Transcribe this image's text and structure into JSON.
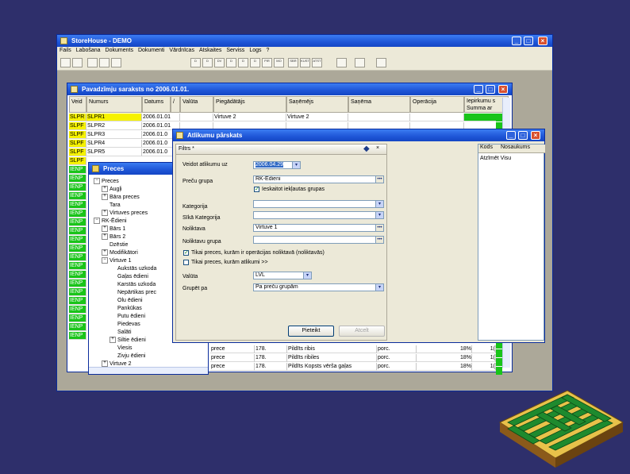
{
  "app": {
    "title": "StoreHouse - DEMO",
    "menu": [
      "Fails",
      "Labošana",
      "Dokuments",
      "Dokumenti",
      "Vārdnīcas",
      "Atskaites",
      "Serviss",
      "Logs",
      "?"
    ],
    "toolbar_buttons": [
      "D",
      "D",
      "DV",
      "D",
      "D",
      "D",
      "PIR",
      "MO",
      "SBR",
      "KUST",
      "ATST"
    ],
    "window_controls": [
      "_",
      "□",
      "×"
    ]
  },
  "list_window": {
    "title": "Pavadzīmju saraksts no 2006.01.01.",
    "columns": [
      "Veid",
      "Numurs",
      "Datums",
      "/",
      "Valūta",
      "Piegādātājs",
      "Saņēmējs",
      "Saņēma",
      "Operācija",
      "Iepirkumu s",
      "Summa ar"
    ],
    "rows": [
      {
        "type": "SLPR",
        "num": "SLPR1",
        "date": "2006.01.01",
        "supplier": "Virtuve 2",
        "receiver": "Virtuve 2"
      },
      {
        "type": "SLPF",
        "num": "SLPR2",
        "date": "2006.01.01",
        "supplier": "",
        "receiver": ""
      },
      {
        "type": "SLPF",
        "num": "SLPR3",
        "date": "2006.01.0",
        "supplier": "",
        "receiver": ""
      },
      {
        "type": "SLPF",
        "num": "SLPR4",
        "date": "2006.01.0",
        "supplier": "",
        "receiver": ""
      },
      {
        "type": "SLPF",
        "num": "SLPR5",
        "date": "2006.01.0",
        "supplier": "",
        "receiver": ""
      }
    ],
    "extra_types": [
      "SLPF",
      "IENP",
      "IENP",
      "IENP",
      "IENP",
      "IENP",
      "IENP",
      "IENP",
      "IENP",
      "IENP",
      "IENP",
      "IENP",
      "IENP",
      "IENP",
      "IENP",
      "IENP",
      "IENP",
      "IENP",
      "IENP",
      "IENP",
      "IENP"
    ],
    "bottom_rows": [
      {
        "c1": "prece",
        "c2": "178.",
        "c3": "Pildīts ribis",
        "c4": "porc.",
        "c5": "18%",
        "c6": "1("
      },
      {
        "c1": "prece",
        "c2": "178.",
        "c3": "Pildīts ribiles",
        "c4": "porc.",
        "c5": "18%",
        "c6": "1("
      },
      {
        "c1": "prece",
        "c2": "178.",
        "c3": "Pildīts Kopsts vērša gaļas",
        "c4": "porc.",
        "c5": "18%",
        "c6": "1("
      }
    ]
  },
  "goods_window": {
    "title": "Preces",
    "tree": [
      {
        "level": 0,
        "exp": "−",
        "label": "Preces"
      },
      {
        "level": 1,
        "exp": "+",
        "label": "Augļi"
      },
      {
        "level": 1,
        "exp": "+",
        "label": "Bāra preces"
      },
      {
        "level": 1,
        "exp": "",
        "label": "Tara"
      },
      {
        "level": 1,
        "exp": "+",
        "label": "Virtuves preces"
      },
      {
        "level": 0,
        "exp": "−",
        "label": "RK-Ēdieni"
      },
      {
        "level": 1,
        "exp": "+",
        "label": "Bārs 1"
      },
      {
        "level": 1,
        "exp": "+",
        "label": "Bārs 2"
      },
      {
        "level": 1,
        "exp": "",
        "label": "Dzēstie"
      },
      {
        "level": 1,
        "exp": "+",
        "label": "Modifikātori"
      },
      {
        "level": 1,
        "exp": "−",
        "label": "Virtuve 1"
      },
      {
        "level": 2,
        "exp": "",
        "label": "Aukstās uzkoda"
      },
      {
        "level": 2,
        "exp": "",
        "label": "Gaļas ēdieni"
      },
      {
        "level": 2,
        "exp": "",
        "label": "Karstās uzkoda"
      },
      {
        "level": 2,
        "exp": "",
        "label": "Nepārtikas prec"
      },
      {
        "level": 2,
        "exp": "",
        "label": "Olu ēdieni"
      },
      {
        "level": 2,
        "exp": "",
        "label": "Pankūkas"
      },
      {
        "level": 2,
        "exp": "",
        "label": "Putu ēdieni"
      },
      {
        "level": 2,
        "exp": "",
        "label": "Piedevas"
      },
      {
        "level": 2,
        "exp": "",
        "label": "Salāti"
      },
      {
        "level": 2,
        "exp": "+",
        "label": "Siltie ēdieni"
      },
      {
        "level": 2,
        "exp": "",
        "label": "Viesis"
      },
      {
        "level": 2,
        "exp": "",
        "label": "Zivju ēdieni"
      },
      {
        "level": 1,
        "exp": "+",
        "label": "Virtuve 2"
      }
    ]
  },
  "dialog": {
    "title": "Atlikumu pārskats",
    "filter_tab": "Filtrs *",
    "pin": "×",
    "fields": {
      "date_label": "Veidot atlikumu uz",
      "date_value": "2006.04.29",
      "group_label": "Preču grupa",
      "group_value": "RK-Ēdieni",
      "include_sub_label": "Ieskaitot iekļautas grupas",
      "include_sub_checked": "✓",
      "category_label": "Kategorija",
      "category_value": "",
      "subcategory_label": "Sīkā Kategorija",
      "subcategory_value": "",
      "warehouse_label": "Noliktava",
      "warehouse_value": "Virtuve 1",
      "wh_group_label": "Noliktavu grupa",
      "wh_group_value": "",
      "only_ops_label": "Tikai preces, kurām ir operācijas noliktavā (noliktavās)",
      "only_ops_checked": "✓",
      "only_neg_label": "Tikai preces, kurām atlikumi >>",
      "only_neg_checked": "",
      "currency_label": "Valūta",
      "currency_value": "LVL",
      "group_by_label": "Grupēt pa",
      "group_by_value": "Pa preču grupām"
    },
    "right_columns": [
      "Kods",
      "Nosaukums"
    ],
    "right_placeholder": "Atzīmēt Visu",
    "buttons": {
      "ok": "Pieteikt",
      "cancel": "Atcelt"
    }
  },
  "colors": {
    "background": "#2e2f6b",
    "title_blue": "#1e55d6",
    "row_yellow": "#f6f200",
    "row_green": "#19c419"
  }
}
